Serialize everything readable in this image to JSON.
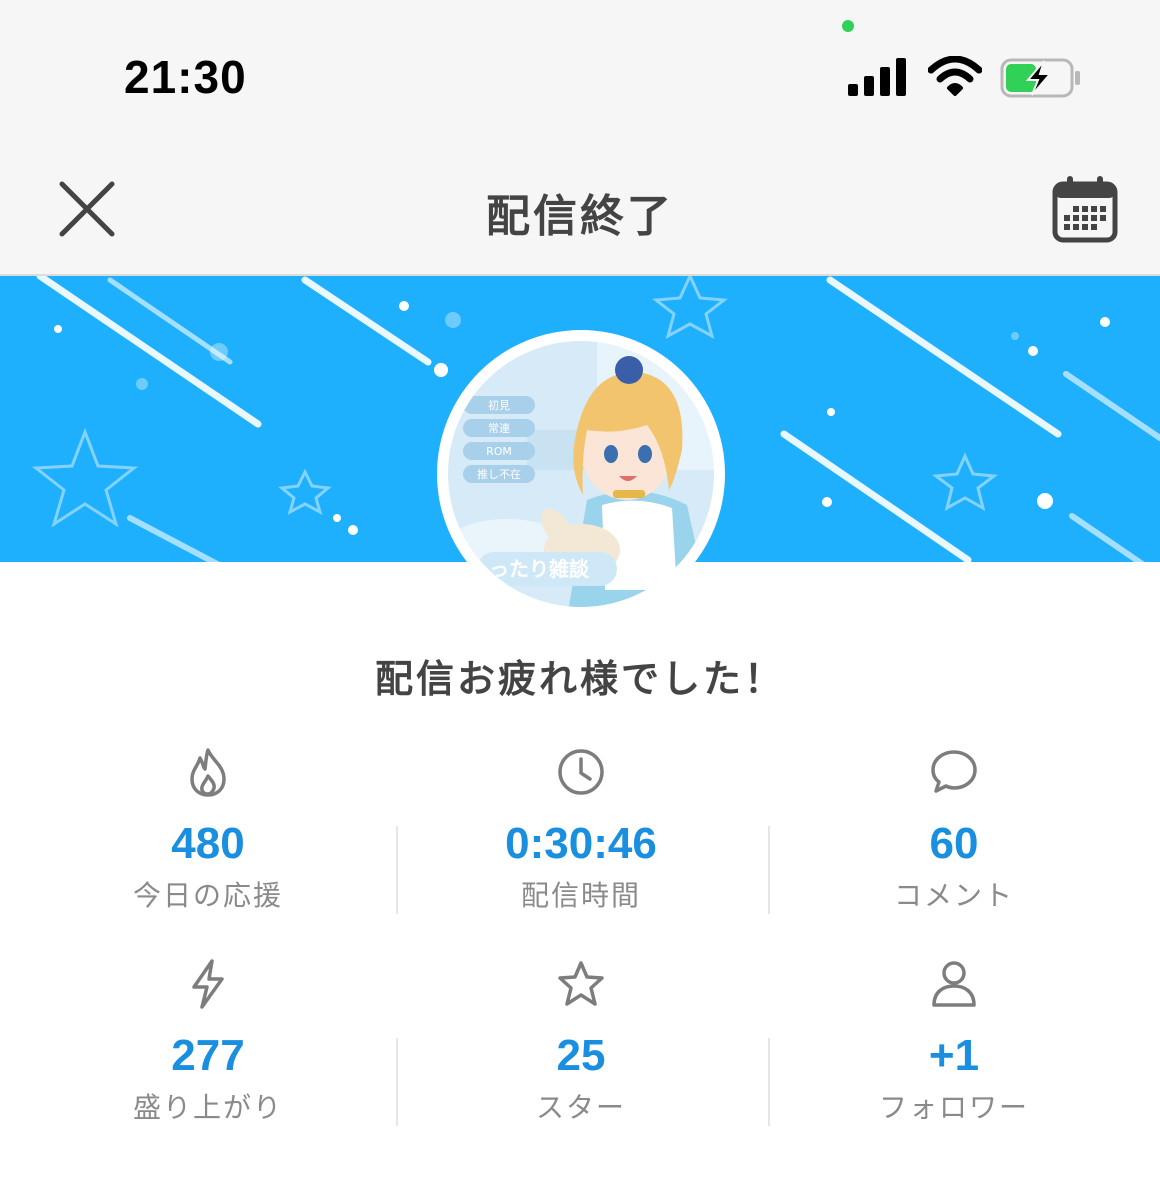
{
  "status_bar": {
    "time": "21:30"
  },
  "header": {
    "title": "配信終了"
  },
  "banner": {
    "accent_color": "#1fb0fd"
  },
  "message": "配信お疲れ様でした！",
  "avatar": {
    "tags": [
      "初見",
      "常連",
      "ROM",
      "推し不在"
    ],
    "caption": "ったり雑談"
  },
  "stats": [
    {
      "icon": "flame-icon",
      "value": "480",
      "label": "今日の応援"
    },
    {
      "icon": "clock-icon",
      "value": "0:30:46",
      "label": "配信時間"
    },
    {
      "icon": "comment-icon",
      "value": "60",
      "label": "コメント"
    },
    {
      "icon": "lightning-icon",
      "value": "277",
      "label": "盛り上がり"
    },
    {
      "icon": "star-icon",
      "value": "25",
      "label": "スター"
    },
    {
      "icon": "user-icon",
      "value": "+1",
      "label": "フォロワー"
    }
  ],
  "colors": {
    "value_blue": "#1a8fe0",
    "label_gray": "#8a8a8a"
  }
}
